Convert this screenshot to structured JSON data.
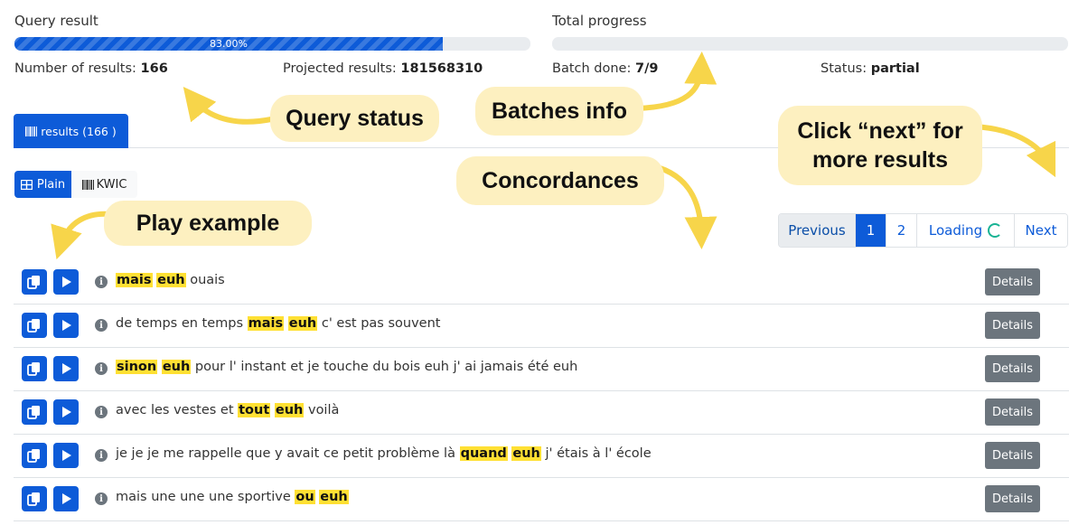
{
  "query": {
    "title": "Query result",
    "progress_label": "83.00%",
    "progress": 0.83,
    "results_label": "Number of results:",
    "results_value": "166",
    "projected_label": "Projected results:",
    "projected_value": "181568310"
  },
  "total": {
    "title": "Total progress",
    "progress": 0.0,
    "batch_label": "Batch done:",
    "batch_value": "7/9",
    "status_label": "Status:",
    "status_value": "partial"
  },
  "tabs": {
    "results_label": "results (166 )"
  },
  "view": {
    "plain_label": "Plain",
    "kwic_label": "KWIC"
  },
  "pagination": {
    "previous": "Previous",
    "page1": "1",
    "page2": "2",
    "loading": "Loading",
    "next": "Next"
  },
  "rows": [
    {
      "pre": "",
      "hit1": "mais",
      "hit2": "euh",
      "post": " ouais",
      "details": "Details"
    },
    {
      "pre": "de temps en temps ",
      "hit1": "mais",
      "hit2": "euh",
      "post": " c' est pas souvent",
      "details": "Details"
    },
    {
      "pre": "",
      "hit1": "sinon",
      "hit2": "euh",
      "post": " pour l' instant et je touche du bois euh j' ai jamais été euh",
      "details": "Details"
    },
    {
      "pre": "avec les vestes et ",
      "hit1": "tout",
      "hit2": "euh",
      "post": " voilà",
      "details": "Details"
    },
    {
      "pre": "je je je me rappelle que y avait ce petit problème là ",
      "hit1": "quand",
      "hit2": "euh",
      "post": " j' étais à l' école",
      "details": "Details"
    },
    {
      "pre": "mais une une une sportive ",
      "hit1": "ou",
      "hit2": "euh",
      "post": "",
      "details": "Details"
    }
  ],
  "callouts": {
    "query_status": "Query status",
    "batches_info": "Batches info",
    "click_next_line1": "Click “next” for",
    "click_next_line2": "more results",
    "concordances": "Concordances",
    "play_example": "Play example"
  },
  "colors": {
    "primary": "#0d5bd8",
    "highlight": "#ffe033",
    "callout": "#fdf0c0",
    "arrow": "#f7d54a",
    "details": "#6c757d"
  }
}
